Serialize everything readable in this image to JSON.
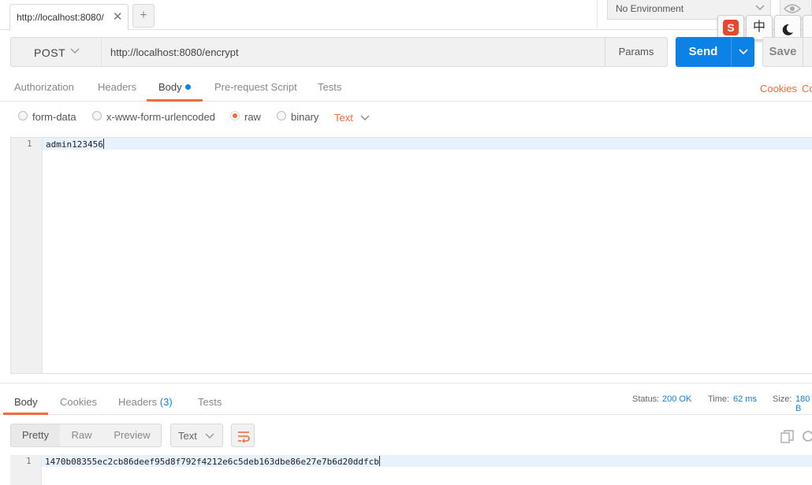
{
  "tabs": {
    "request_tab_label": "http://localhost:8080/",
    "close_glyph": "✕",
    "new_tab_glyph": "+"
  },
  "environment": {
    "selected": "No Environment"
  },
  "ime": {
    "logo_letter": "S",
    "lang_label": "中"
  },
  "request": {
    "method": "POST",
    "url": "http://localhost:8080/encrypt",
    "params_label": "Params",
    "send_label": "Send",
    "save_label": "Save"
  },
  "request_tabs": {
    "authorization": "Authorization",
    "headers": "Headers",
    "body": "Body",
    "pre_request": "Pre-request Script",
    "tests": "Tests",
    "cookies_link": "Cookies",
    "codes_link": "Code"
  },
  "body_types": {
    "form_data": "form-data",
    "urlencoded": "x-www-form-urlencoded",
    "raw": "raw",
    "binary": "binary",
    "content_type": "Text",
    "selected": "raw"
  },
  "request_editor": {
    "line_number": "1",
    "content": "admin123456"
  },
  "response_tabs": {
    "body": "Body",
    "cookies": "Cookies",
    "headers": "Headers",
    "headers_count": "(3)",
    "tests": "Tests"
  },
  "response_status": {
    "status_label": "Status:",
    "status_value": "200 OK",
    "time_label": "Time:",
    "time_value": "62 ms",
    "size_label": "Size:",
    "size_value": "180 B"
  },
  "response_view": {
    "pretty": "Pretty",
    "raw": "Raw",
    "preview": "Preview",
    "format": "Text"
  },
  "response_editor": {
    "line_number": "1",
    "content": "1470b08355ec2cb86deef95d8f792f4212e6c5deb163dbe86e27e7b6d20ddfcb"
  },
  "colors": {
    "accent_orange": "#f26b3a",
    "send_blue": "#0c82e6"
  },
  "icons": [
    "close-icon",
    "plus-icon",
    "chevron-down-icon",
    "eye-icon",
    "sogou-ime-icon",
    "moon-icon",
    "wrap-lines-icon",
    "copy-icon",
    "search-icon"
  ]
}
